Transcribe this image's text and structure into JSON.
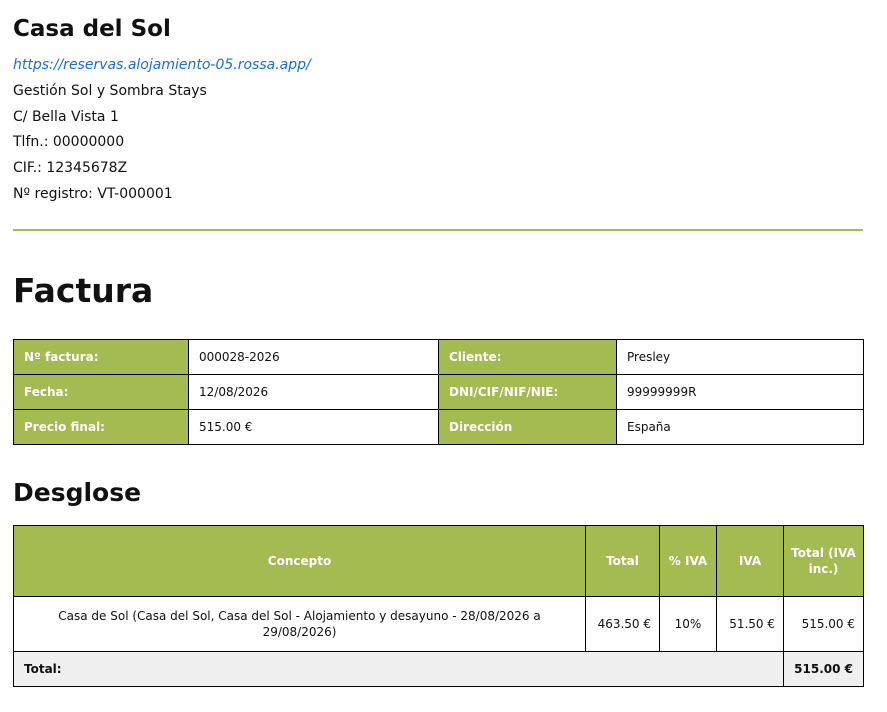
{
  "company": {
    "name": "Casa del Sol",
    "url": "https://reservas.alojamiento-05.rossa.app/",
    "manager": "Gestión Sol y Sombra Stays",
    "address": "C/ Bella Vista 1",
    "phone": "Tlfn.: 00000000",
    "cif": "CIF.: 12345678Z",
    "registry": "Nº registro: VT-000001"
  },
  "invoice": {
    "title": "Factura",
    "number_label": "Nº factura:",
    "number": "000028-2026",
    "client_label": "Cliente:",
    "client": "Presley",
    "date_label": "Fecha:",
    "date": "12/08/2026",
    "id_label": "DNI/CIF/NIF/NIE:",
    "id": "99999999R",
    "price_label": "Precio final:",
    "price": "515.00 €",
    "address_label": "Dirección",
    "address": "España"
  },
  "breakdown": {
    "title": "Desglose",
    "headers": {
      "concept": "Concepto",
      "total": "Total",
      "vat_pct": "% IVA",
      "vat": "IVA",
      "total_inc": "Total (IVA inc.)"
    },
    "rows": [
      {
        "concept": "Casa de Sol (Casa del Sol, Casa del Sol - Alojamiento y desayuno - 28/08/2026 a 29/08/2026)",
        "total": "463.50 €",
        "vat_pct": "10%",
        "vat": "51.50 €",
        "total_inc": "515.00 €"
      }
    ],
    "total_label": "Total:",
    "total_value": "515.00 €"
  },
  "colors": {
    "accent": "#a3bb51",
    "link": "#1a6fd1",
    "total_row_bg": "#f0f0f0"
  }
}
